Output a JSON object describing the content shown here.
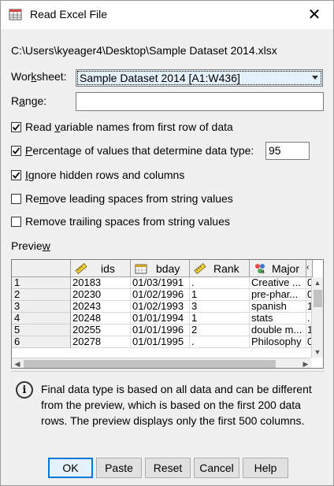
{
  "window": {
    "title": "Read Excel File"
  },
  "file_path": "C:\\Users\\kyeager4\\Desktop\\Sample Dataset 2014.xlsx",
  "worksheet": {
    "label_pre": "Wor",
    "label_key": "k",
    "label_post": "sheet:",
    "value": "Sample Dataset 2014 [A1:W436]"
  },
  "range": {
    "label_pre": "R",
    "label_key": "a",
    "label_post": "nge:",
    "value": ""
  },
  "options": [
    {
      "pre": "Read ",
      "key": "v",
      "post": "ariable names from first row of data",
      "checked": true
    },
    {
      "pre": "",
      "key": "P",
      "post": "ercentage of values that determine data type:",
      "checked": true,
      "value": "95"
    },
    {
      "pre": "",
      "key": "I",
      "post": "gnore hidden rows and columns",
      "checked": true
    },
    {
      "pre": "Re",
      "key": "m",
      "post": "ove leading spaces from string values",
      "checked": false
    },
    {
      "pre": "Remove trailing spaces from string values",
      "key": "",
      "post": "",
      "checked": false
    }
  ],
  "preview": {
    "label_pre": "Previe",
    "label_key": "w",
    "label_post": "",
    "columns": [
      {
        "name": "ids",
        "icon": "ruler-icon"
      },
      {
        "name": "bday",
        "icon": "calendar-icon"
      },
      {
        "name": "Rank",
        "icon": "ruler-icon"
      },
      {
        "name": "Major",
        "icon": "nominal-icon"
      }
    ],
    "rows": [
      {
        "n": "1",
        "cells": [
          "20183",
          "01/03/1991",
          ".",
          "Creative ..."
        ]
      },
      {
        "n": "2",
        "cells": [
          "20230",
          "01/02/1996",
          "1",
          "pre-phar..."
        ]
      },
      {
        "n": "3",
        "cells": [
          "20243",
          "01/02/1993",
          "3",
          "spanish"
        ]
      },
      {
        "n": "4",
        "cells": [
          "20248",
          "01/01/1994",
          "1",
          "stats"
        ]
      },
      {
        "n": "5",
        "cells": [
          "20255",
          "01/01/1996",
          "2",
          "double m..."
        ]
      },
      {
        "n": "6",
        "cells": [
          "20278",
          "01/01/1995",
          ".",
          "Philosophy"
        ]
      }
    ],
    "extra_col": [
      "0",
      "0",
      "1",
      ".",
      "1",
      "0"
    ]
  },
  "info": "Final data type is based on all data and can be different from the preview, which is based on the first 200 data rows. The preview displays only the first 500 columns.",
  "buttons": {
    "ok": "OK",
    "paste": "Paste",
    "reset": "Reset",
    "cancel": "Cancel",
    "help": "Help"
  },
  "colors": {
    "accent": "#0078d7",
    "select_bg": "#e5f1fb"
  }
}
